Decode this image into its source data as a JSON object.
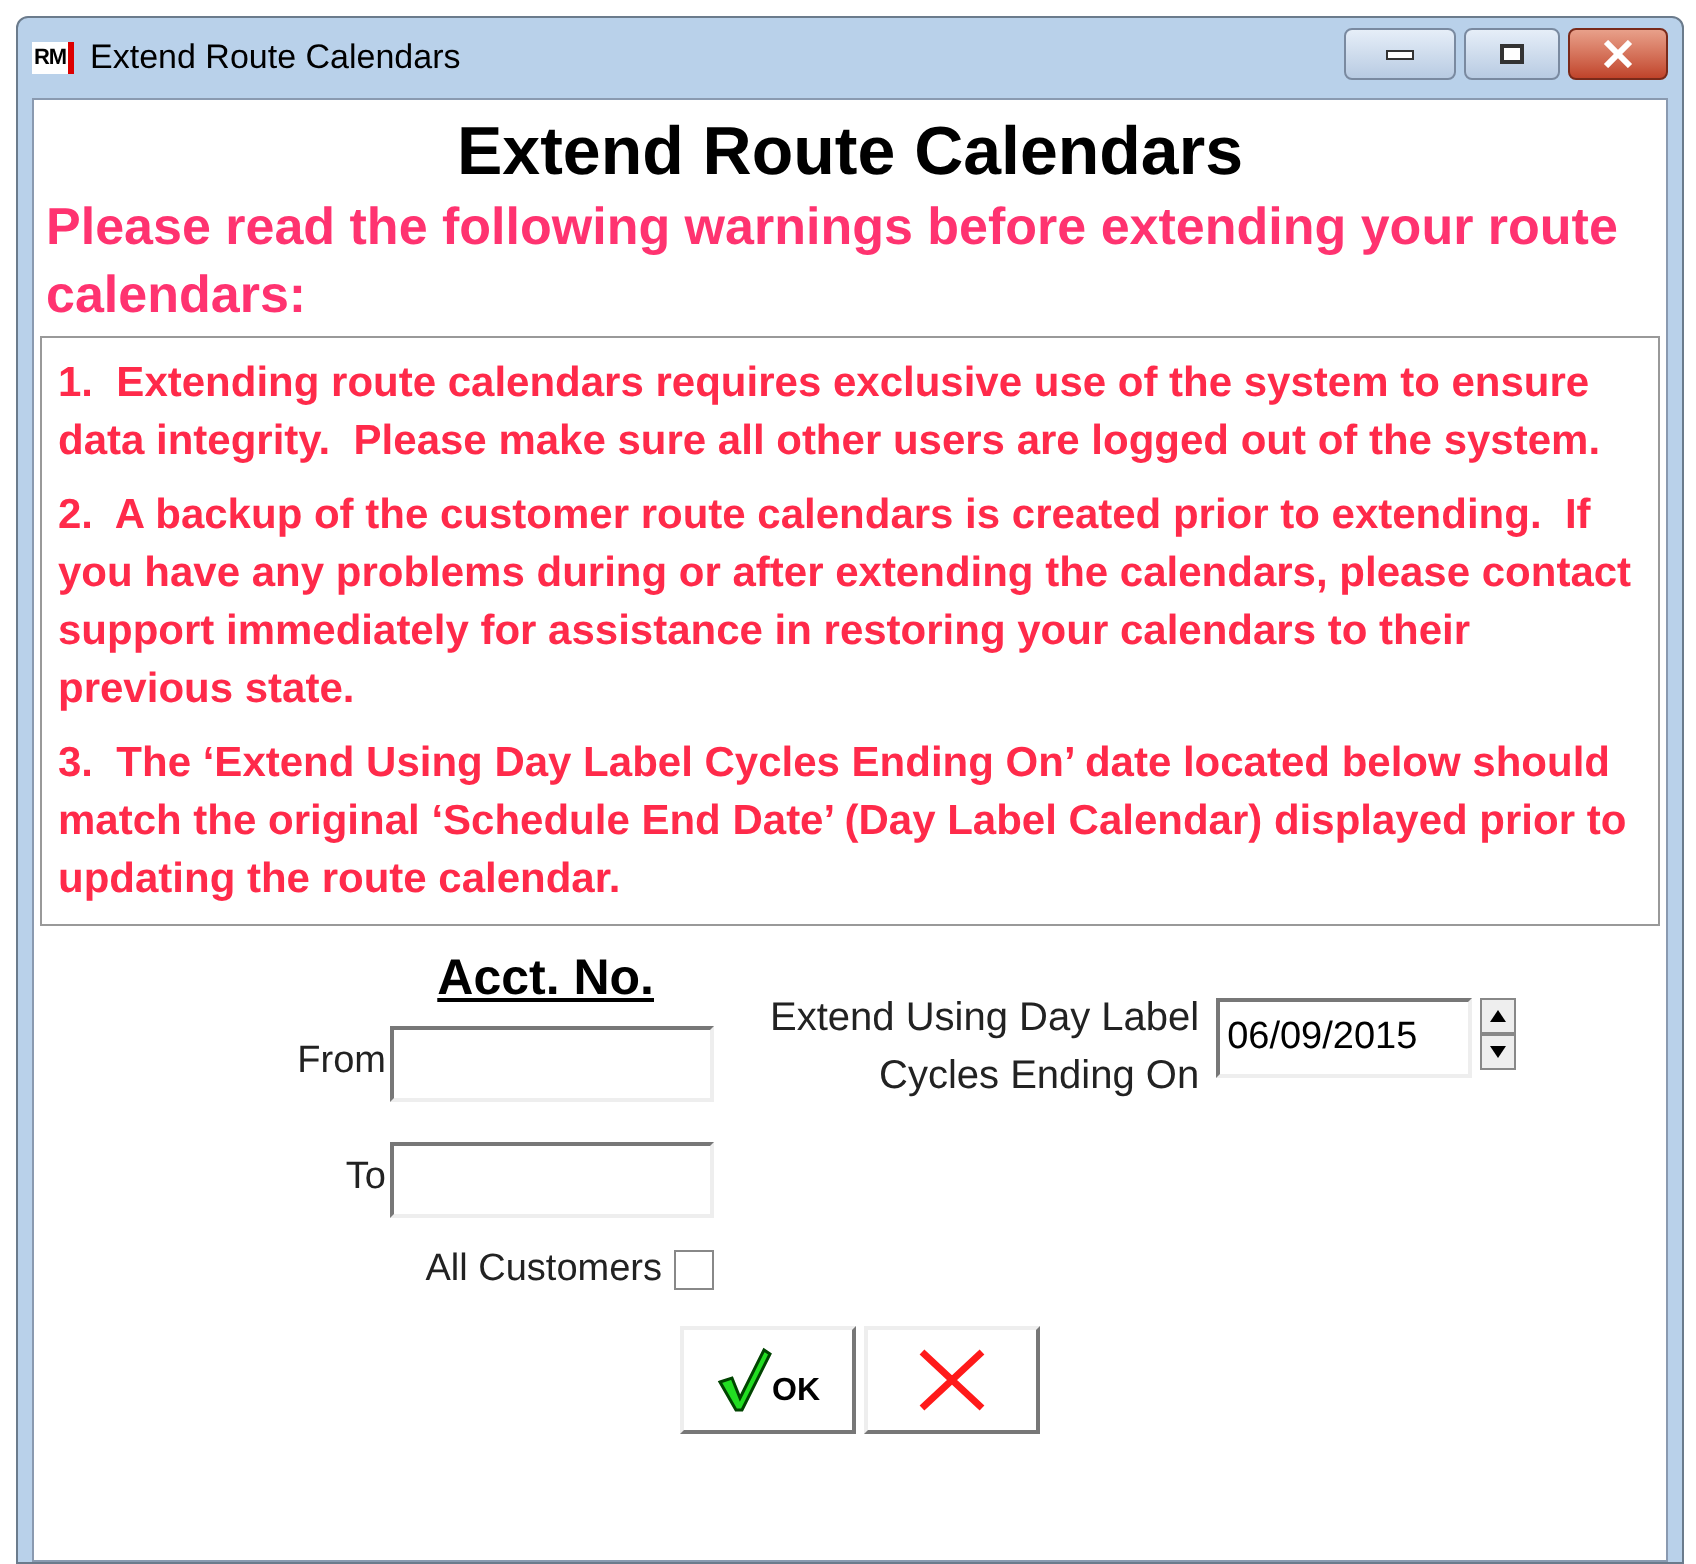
{
  "window": {
    "logo": "RM",
    "title": "Extend Route Calendars"
  },
  "heading": "Extend Route Calendars",
  "warning_intro": "Please read the following warnings before extending your route calendars:",
  "warnings": [
    "1.  Extending route calendars requires exclusive use of the system to ensure data integrity.  Please make sure all other users are logged out of the system.",
    "2.  A backup of the customer route calendars is created prior to extending.  If you have any problems during or after extending the calendars, please contact support immediately for assistance in restoring your calendars to their previous state.",
    "3.  The ‘Extend Using Day Label Cycles Ending On’ date located below should match the original ‘Schedule End Date’ (Day Label Calendar) displayed prior to updating the route calendar."
  ],
  "acct_heading": "Acct. No.",
  "from_label": "From",
  "to_label": "To",
  "all_customers": {
    "label": "All Customers",
    "checked": false
  },
  "date_label": [
    "Extend Using Day Label",
    "Cycles Ending On"
  ],
  "date_value": "06/09/2015",
  "ok_label": "OK"
}
